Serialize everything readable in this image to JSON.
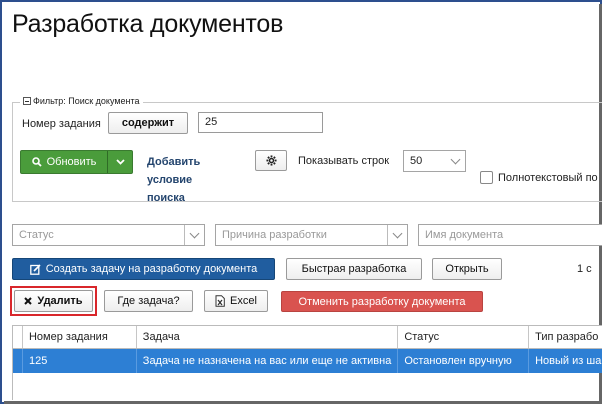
{
  "page": {
    "title": "Разработка документов"
  },
  "filter": {
    "legend": "Фильтр: Поиск документа",
    "task_number_label": "Номер задания",
    "operator_label": "содержит",
    "task_number_value": "25",
    "refresh_label": "Обновить",
    "add_condition_label": "Добавить условие поиска",
    "rows_label": "Показывать строк",
    "rows_value": "50",
    "fulltext_label": "Полнотекстовый по"
  },
  "selects": {
    "status_placeholder": "Статус",
    "reason_placeholder": "Причина разработки",
    "docname_placeholder": "Имя документа"
  },
  "toolbar": {
    "create_task_label": "Создать задачу на разработку документа",
    "quick_dev_label": "Быстрая разработка",
    "open_label": "Открыть",
    "page_info": "1 с",
    "delete_label": "Удалить",
    "where_task_label": "Где задача?",
    "excel_label": "Excel",
    "cancel_dev_label": "Отменить разработку документа"
  },
  "table": {
    "headers": [
      "Номер задания",
      "Задача",
      "Статус",
      "Тип разрабо"
    ],
    "rows": [
      [
        "125",
        "Задача не назначена на вас или еще не активна",
        "Остановлен вручную",
        "Новый из ша"
      ]
    ]
  },
  "colors": {
    "accent_green": "#4a9c3b",
    "accent_blue": "#205d9f",
    "danger_red": "#d9534f",
    "selected_row": "#2d7fd4"
  }
}
